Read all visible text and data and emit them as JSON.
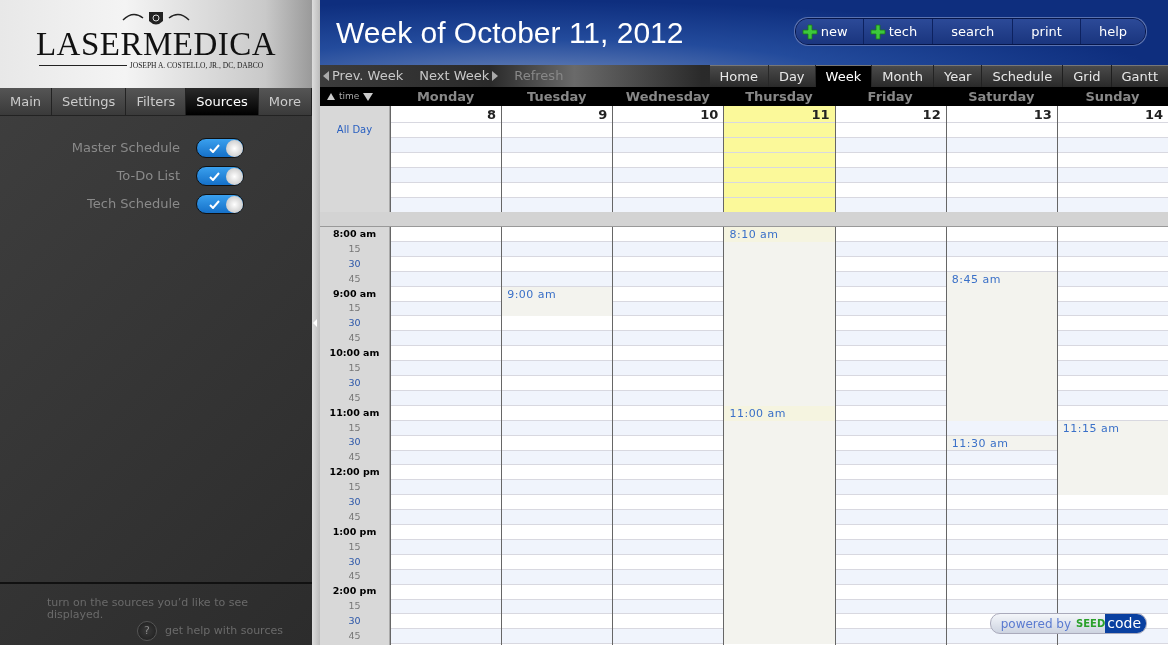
{
  "sidebar": {
    "logo": {
      "name": "LASERMEDICA",
      "tagline": "JOSEPH A. COSTELLO, JR., DC, DABCO"
    },
    "tabs": [
      {
        "label": "Main",
        "selected": false
      },
      {
        "label": "Settings",
        "selected": false
      },
      {
        "label": "Filters",
        "selected": false
      },
      {
        "label": "Sources",
        "selected": true
      },
      {
        "label": "More",
        "selected": false
      }
    ],
    "sources": [
      {
        "label": "Master Schedule",
        "on": true
      },
      {
        "label": "To-Do List",
        "on": true
      },
      {
        "label": "Tech Schedule",
        "on": true
      }
    ],
    "hint": "turn on the sources you’d like to see displayed.",
    "help": {
      "icon": "?",
      "label": "get help with sources"
    }
  },
  "header": {
    "title": "Week of October 11, 2012",
    "buttons": [
      {
        "label": "new",
        "kind": "add"
      },
      {
        "label": "tech",
        "kind": "add"
      },
      {
        "label": "search",
        "kind": "plain"
      },
      {
        "label": "print",
        "kind": "plain"
      },
      {
        "label": "help",
        "kind": "plain"
      }
    ]
  },
  "nav": {
    "links": [
      {
        "label": "Prev. Week",
        "kind": "prev",
        "disabled": false
      },
      {
        "label": "Next Week",
        "kind": "next",
        "disabled": false
      },
      {
        "label": "Refresh",
        "kind": "plain",
        "disabled": true
      }
    ],
    "views": [
      {
        "label": "Home",
        "selected": false
      },
      {
        "label": "Day",
        "selected": false
      },
      {
        "label": "Week",
        "selected": true
      },
      {
        "label": "Month",
        "selected": false
      },
      {
        "label": "Year",
        "selected": false
      },
      {
        "label": "Schedule",
        "selected": false
      },
      {
        "label": "Grid",
        "selected": false
      },
      {
        "label": "Gantt",
        "selected": false
      }
    ]
  },
  "calendar": {
    "time_header": "time",
    "all_day_label": "All Day",
    "days": [
      {
        "name": "Monday",
        "date": "8",
        "today": false
      },
      {
        "name": "Tuesday",
        "date": "9",
        "today": false,
        "events": [
          {
            "time": "9:00 am"
          }
        ]
      },
      {
        "name": "Wednesday",
        "date": "10",
        "today": false
      },
      {
        "name": "Thursday",
        "date": "11",
        "today": true,
        "events": [
          {
            "time": "8:10 am"
          },
          {
            "time": "11:00 am"
          }
        ]
      },
      {
        "name": "Friday",
        "date": "12",
        "today": false
      },
      {
        "name": "Saturday",
        "date": "13",
        "today": false,
        "events": [
          {
            "time": "8:45 am"
          },
          {
            "time": "11:30 am"
          }
        ]
      },
      {
        "name": "Sunday",
        "date": "14",
        "today": false,
        "events": [
          {
            "time": "11:15 am"
          }
        ]
      }
    ],
    "time_slots": [
      {
        "label": "8:00 am",
        "kind": "hour"
      },
      {
        "label": "15",
        "kind": "quarter"
      },
      {
        "label": "30",
        "kind": "half"
      },
      {
        "label": "45",
        "kind": "quarter"
      },
      {
        "label": "9:00 am",
        "kind": "hour"
      },
      {
        "label": "15",
        "kind": "quarter"
      },
      {
        "label": "30",
        "kind": "half"
      },
      {
        "label": "45",
        "kind": "quarter"
      },
      {
        "label": "10:00 am",
        "kind": "hour"
      },
      {
        "label": "15",
        "kind": "quarter"
      },
      {
        "label": "30",
        "kind": "half"
      },
      {
        "label": "45",
        "kind": "quarter"
      },
      {
        "label": "11:00 am",
        "kind": "hour"
      },
      {
        "label": "15",
        "kind": "quarter"
      },
      {
        "label": "30",
        "kind": "half"
      },
      {
        "label": "45",
        "kind": "quarter"
      },
      {
        "label": "12:00 pm",
        "kind": "hour"
      },
      {
        "label": "15",
        "kind": "quarter"
      },
      {
        "label": "30",
        "kind": "half"
      },
      {
        "label": "45",
        "kind": "quarter"
      },
      {
        "label": "1:00 pm",
        "kind": "hour"
      },
      {
        "label": "15",
        "kind": "quarter"
      },
      {
        "label": "30",
        "kind": "half"
      },
      {
        "label": "45",
        "kind": "quarter"
      },
      {
        "label": "2:00 pm",
        "kind": "hour"
      },
      {
        "label": "15",
        "kind": "quarter"
      },
      {
        "label": "30",
        "kind": "half"
      },
      {
        "label": "45",
        "kind": "quarter"
      }
    ]
  },
  "badge": {
    "prefix": "powered by",
    "brand": [
      "SEED",
      "code"
    ]
  }
}
